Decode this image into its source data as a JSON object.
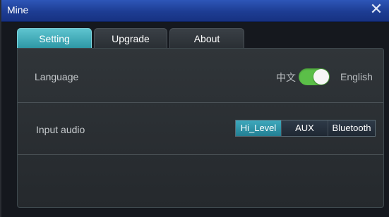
{
  "window": {
    "title": "Mine"
  },
  "tabs": [
    {
      "label": "Setting",
      "active": true
    },
    {
      "label": "Upgrade",
      "active": false
    },
    {
      "label": "About",
      "active": false
    }
  ],
  "settings": {
    "language": {
      "label": "Language",
      "option_left": "中文",
      "option_right": "English",
      "selected": "English"
    },
    "input_audio": {
      "label": "Input audio",
      "options": [
        "Hi_Level",
        "AUX",
        "Bluetooth"
      ],
      "selected": "Hi_Level"
    }
  },
  "colors": {
    "titlebar": "#1d3d93",
    "active_tab": "#3ea9b6",
    "toggle_on": "#5bbf48",
    "segment_selected": "#2f93a8"
  }
}
